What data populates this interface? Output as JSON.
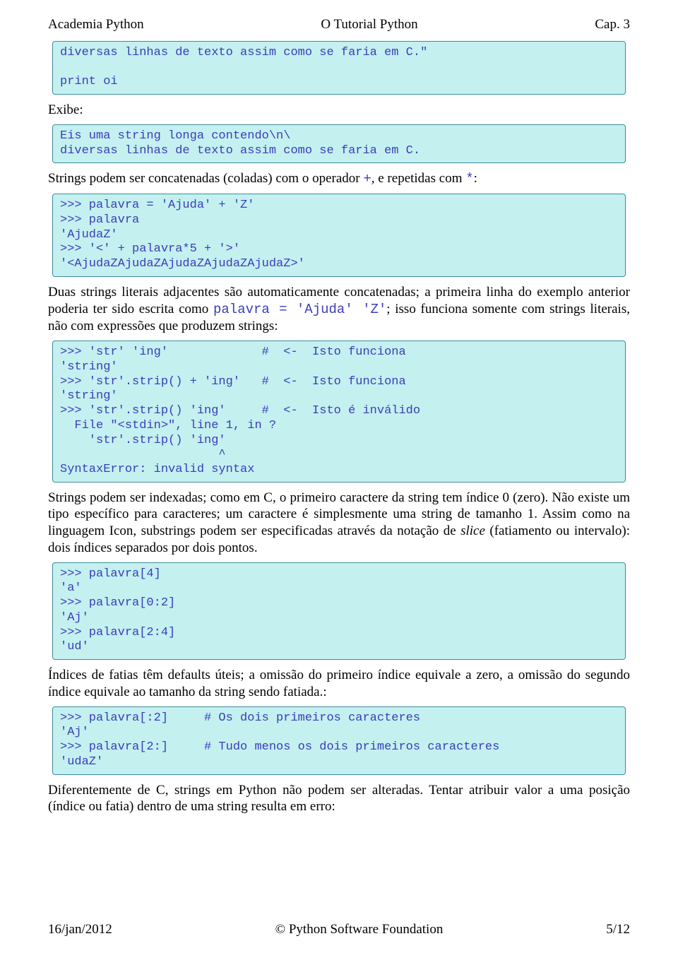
{
  "header": {
    "left": "Academia Python",
    "center": "O Tutorial Python",
    "right": "Cap. 3"
  },
  "code1": "diversas linhas de texto assim como se faria em C.\"\n\nprint oi",
  "exibe": "Exibe:",
  "code2": "Eis uma string longa contendo\\n\\\ndiversas linhas de texto assim como se faria em C.",
  "p_concat_pre": "Strings podem ser concatenadas (coladas) com o operador ",
  "p_concat_plus": "+",
  "p_concat_mid": ", e repetidas com ",
  "p_concat_star": "*",
  "p_concat_post": ":",
  "code3": ">>> palavra = 'Ajuda' + 'Z'\n>>> palavra\n'AjudaZ'\n>>> '<' + palavra*5 + '>'\n'<AjudaZAjudaZAjudaZAjudaZAjudaZ>'",
  "p_adjacent_pre": "Duas strings literais adjacentes são automaticamente concatenadas; a primeira linha do exemplo anterior poderia ter sido escrita como ",
  "p_adjacent_code": "palavra = 'Ajuda' 'Z'",
  "p_adjacent_post": "; isso funciona somente com strings literais, não com expressões que produzem strings:",
  "code4": ">>> 'str' 'ing'             #  <-  Isto funciona\n'string'\n>>> 'str'.strip() + 'ing'   #  <-  Isto funciona\n'string'\n>>> 'str'.strip() 'ing'     #  <-  Isto é inválido\n  File \"<stdin>\", line 1, in ?\n    'str'.strip() 'ing'\n                      ^\nSyntaxError: invalid syntax",
  "p_index_pre": "Strings podem ser indexadas; como em C, o primeiro caractere da string tem índice 0 (zero). Não existe um tipo específico para caracteres; um caractere é simplesmente uma string de tamanho 1. Assim como na linguagem Icon, substrings podem ser especificadas através da notação de ",
  "p_index_slice": "slice",
  "p_index_post": " (fatiamento ou intervalo): dois índices separados por dois pontos.",
  "code5": ">>> palavra[4]\n'a'\n>>> palavra[0:2]\n'Aj'\n>>> palavra[2:4]\n'ud'",
  "p_defaults": "Índices de fatias têm defaults úteis; a omissão do primeiro índice equivale a zero, a omissão do segundo índice equivale ao tamanho da string sendo fatiada.:",
  "code6": ">>> palavra[:2]     # Os dois primeiros caracteres\n'Aj'\n>>> palavra[2:]     # Tudo menos os dois primeiros caracteres\n'udaZ'",
  "p_immutable": "Diferentemente de C, strings em Python não podem ser alteradas. Tentar atribuir valor a uma posição (índice ou fatia) dentro de uma string resulta em erro:",
  "footer": {
    "left": "16/jan/2012",
    "center": "© Python Software Foundation",
    "right": "5/12"
  }
}
